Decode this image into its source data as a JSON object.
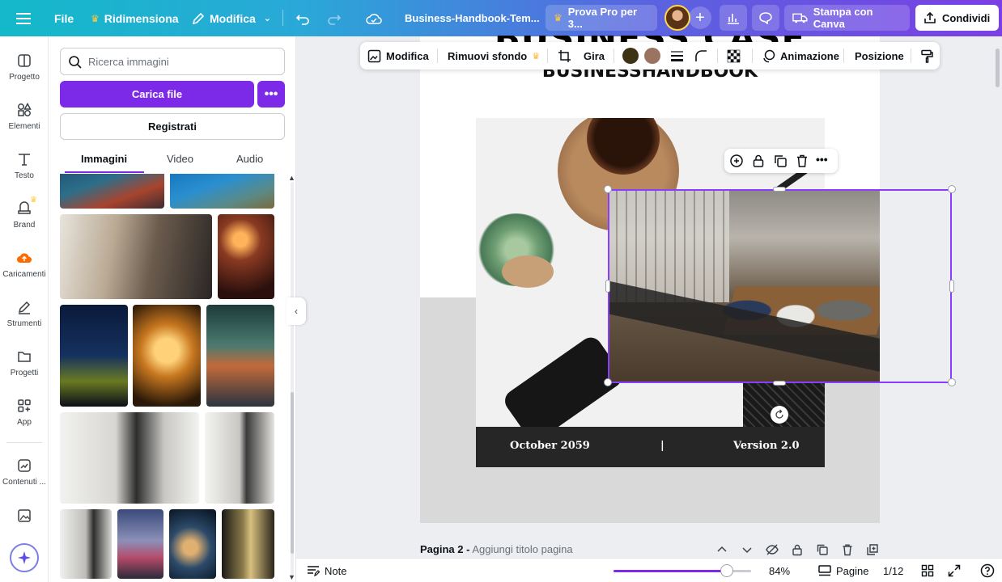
{
  "topbar": {
    "menu_icon": "hamburger-icon",
    "file": "File",
    "resize": "Ridimensiona",
    "edit": "Modifica",
    "doc_title": "Business-Handbook-Tem...",
    "try_pro": "Prova Pro per 3...",
    "print": "Stampa con Canva",
    "share": "Condividi"
  },
  "rail": {
    "items": [
      {
        "label": "Progetto",
        "icon": "layout-icon"
      },
      {
        "label": "Elementi",
        "icon": "shapes-icon"
      },
      {
        "label": "Testo",
        "icon": "text-icon"
      },
      {
        "label": "Brand",
        "icon": "brand-icon"
      },
      {
        "label": "Caricamenti",
        "icon": "cloud-upload-icon"
      },
      {
        "label": "Strumenti",
        "icon": "pen-icon"
      },
      {
        "label": "Progetti",
        "icon": "folder-icon"
      },
      {
        "label": "App",
        "icon": "apps-icon"
      },
      {
        "label": "Contenuti ...",
        "icon": "content-icon"
      }
    ]
  },
  "panel": {
    "search_placeholder": "Ricerca immagini",
    "upload": "Carica file",
    "register": "Registrati",
    "tabs": [
      "Immagini",
      "Video",
      "Audio"
    ]
  },
  "context_toolbar": {
    "edit": "Modifica",
    "remove_bg": "Rimuovi sfondo",
    "flip": "Gira",
    "animate": "Animazione",
    "position": "Posizione",
    "swatch_1": "#3d3314",
    "swatch_2": "#9a7460"
  },
  "canvas": {
    "heading1": "BUSINESS CASE",
    "heading2": "BUSINESSHANDBOOK",
    "footer_date": "October 2059",
    "footer_sep": "|",
    "footer_version": "Version 2.0"
  },
  "page_info": {
    "label": "Pagina 2 -",
    "placeholder": "Aggiungi titolo pagina"
  },
  "bottombar": {
    "notes": "Note",
    "zoom_value": 84,
    "zoom": "84%",
    "pages": "Pagine",
    "page_count": "1/12"
  },
  "colors": {
    "accent": "#7d2ae8",
    "selection": "#8b3dff"
  }
}
